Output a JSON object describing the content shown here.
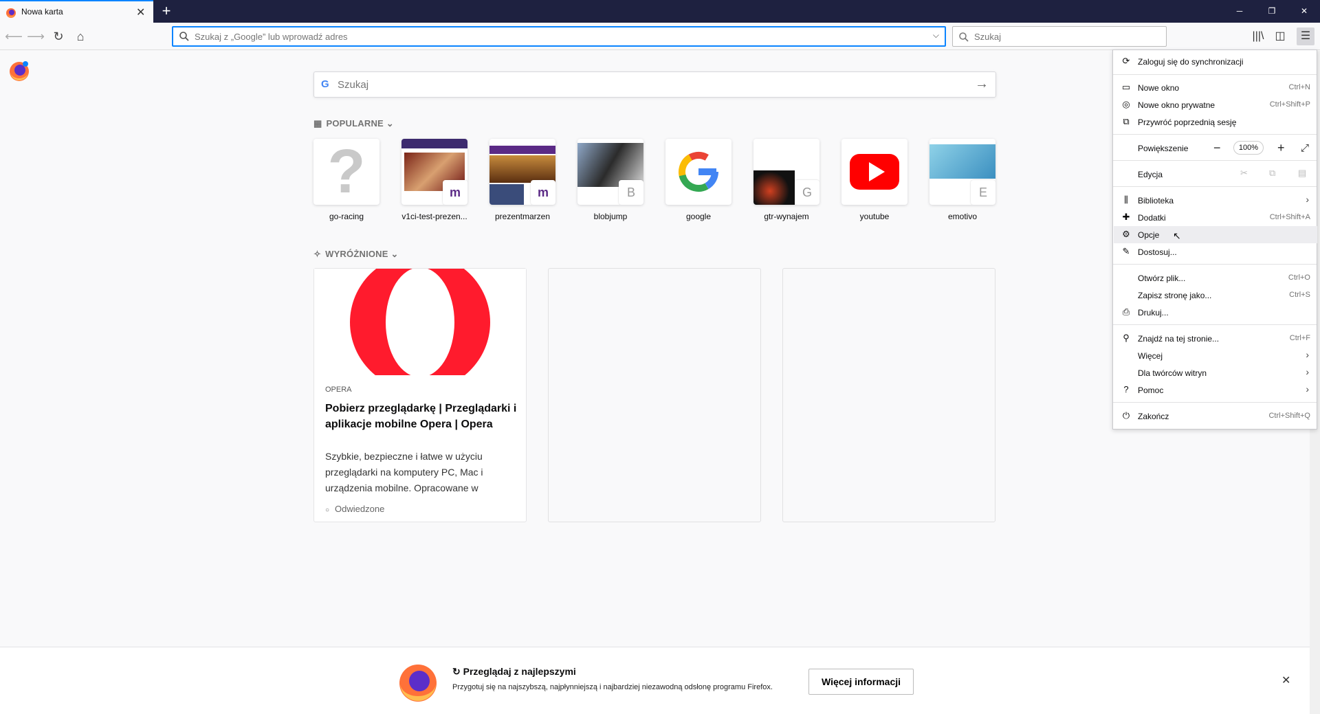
{
  "tab": {
    "title": "Nowa karta"
  },
  "urlbar": {
    "placeholder": "Szukaj z „Google” lub wprowadź adres"
  },
  "searchbar": {
    "placeholder": "Szukaj"
  },
  "newtab": {
    "search_placeholder": "Szukaj",
    "topsites_heading": "POPULARNE",
    "highlights_heading": "WYRÓŻNIONE",
    "topsites": [
      {
        "label": "go-racing"
      },
      {
        "label": "v1ci-test-prezen..."
      },
      {
        "label": "prezentmarzen"
      },
      {
        "label": "blobjump",
        "badge": "B"
      },
      {
        "label": "google"
      },
      {
        "label": "gtr-wynajem",
        "badge": "G"
      },
      {
        "label": "youtube"
      },
      {
        "label": "emotivo",
        "badge": "E"
      }
    ],
    "highlight": {
      "source": "OPERA",
      "title": "Pobierz przeglądarkę | Przeglądarki i aplikacje mobilne Opera | Opera",
      "description": "Szybkie, bezpieczne i łatwe w użyciu przeglądarki na komputery PC, Mac i urządzenia mobilne. Opracowane w",
      "context": "Odwiedzone"
    }
  },
  "menu": {
    "sync": "Zaloguj się do synchronizacji",
    "new_window": {
      "label": "Nowe okno",
      "shortcut": "Ctrl+N"
    },
    "private_window": {
      "label": "Nowe okno prywatne",
      "shortcut": "Ctrl+Shift+P"
    },
    "restore": "Przywróć poprzednią sesję",
    "zoom": {
      "label": "Powiększenie",
      "value": "100%"
    },
    "edit": "Edycja",
    "library": "Biblioteka",
    "addons": {
      "label": "Dodatki",
      "shortcut": "Ctrl+Shift+A"
    },
    "options": "Opcje",
    "customize": "Dostosuj...",
    "open_file": {
      "label": "Otwórz plik...",
      "shortcut": "Ctrl+O"
    },
    "save_page": {
      "label": "Zapisz stronę jako...",
      "shortcut": "Ctrl+S"
    },
    "print": "Drukuj...",
    "find": {
      "label": "Znajdź na tej stronie...",
      "shortcut": "Ctrl+F"
    },
    "more": "Więcej",
    "web_dev": "Dla twórców witryn",
    "help": "Pomoc",
    "quit": {
      "label": "Zakończ",
      "shortcut": "Ctrl+Shift+Q"
    }
  },
  "notification": {
    "heading": "Przeglądaj z najlepszymi",
    "body": "Przygotuj się na najszybszą, najpłynniejszą i najbardziej niezawodną odsłonę programu Firefox.",
    "button": "Więcej informacji"
  },
  "colors": {
    "accent": "#0a84ff",
    "titlebar": "#1e2140"
  }
}
